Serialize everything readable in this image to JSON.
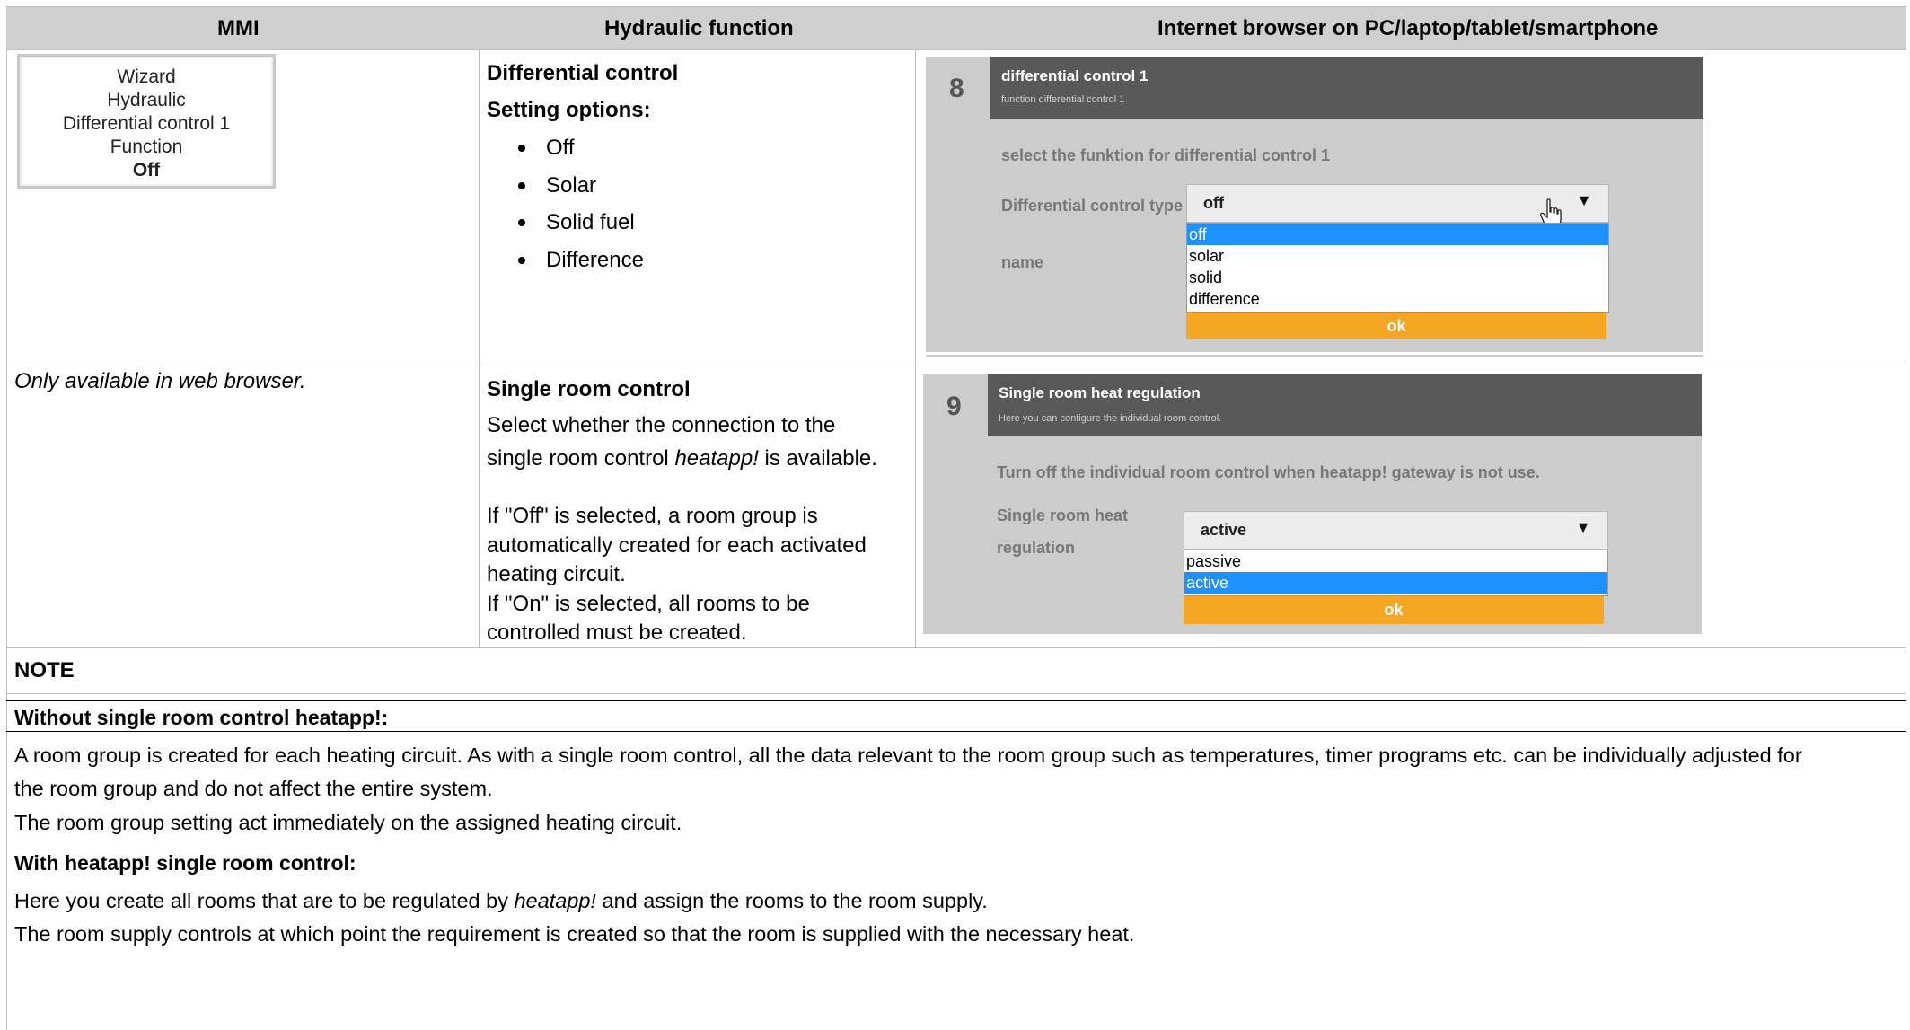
{
  "header": {
    "col1": "MMI",
    "col2": "Hydraulic function",
    "col3": "Internet browser on PC/laptop/tablet/smartphone"
  },
  "row1": {
    "mmi_lines": [
      "Wizard",
      "Hydraulic",
      "Differential control 1",
      "Function",
      "Off"
    ],
    "title": "Differential control",
    "setting_label": "Setting options:",
    "options": [
      "Off",
      "Solar",
      "Solid fuel",
      "Difference"
    ],
    "screen": {
      "step": "8",
      "title": "differential control 1",
      "subtitle": "function differential control 1",
      "instruction": "select the funktion for differential control 1",
      "field_label": "Differential control type",
      "selected": "off",
      "name_label": "name",
      "dropdown": [
        "off",
        "solar",
        "solid",
        "difference"
      ],
      "highlighted": "off",
      "ok": "ok"
    }
  },
  "row2": {
    "mmi_note": "Only available in web browser.",
    "title": "Single room control",
    "desc_line1": "Select whether the connection to the",
    "desc_line2_pre": "single room control ",
    "desc_line2_em": "heatapp!",
    "desc_line2_post": " is available.",
    "p2": [
      "If \"Off\" is selected, a room group is",
      "automatically created for each activated",
      "heating circuit.",
      "If \"On\" is selected, all rooms to be",
      "controlled must be created."
    ],
    "screen": {
      "step": "9",
      "title": "Single room heat regulation",
      "subtitle": "Here you can configure the individual room control.",
      "instruction": "Turn off the individual room control when heatapp! gateway is not use.",
      "field_label_1": "Single room heat",
      "field_label_2": "regulation",
      "selected": "active",
      "dropdown": [
        "passive",
        "active"
      ],
      "highlighted": "active",
      "ok": "ok"
    }
  },
  "note": {
    "heading": "NOTE",
    "sub1": "Without single room control heatapp!:",
    "p1a": "A room group is created for each heating circuit. As with a single room control, all the data relevant to the room group such as temperatures, timer programs etc. can be individually adjusted for",
    "p1b": "the room group and do not affect the entire system.",
    "p2": "The room group setting act immediately on the assigned heating circuit.",
    "sub2": "With heatapp! single room control:",
    "p3_pre": "Here you create all rooms that are to be regulated by ",
    "p3_em": "heatapp!",
    "p3_post": " and assign the rooms to the room supply.",
    "p4": "The room supply controls at which point the requirement is created so that the room is supplied with the necessary heat."
  }
}
